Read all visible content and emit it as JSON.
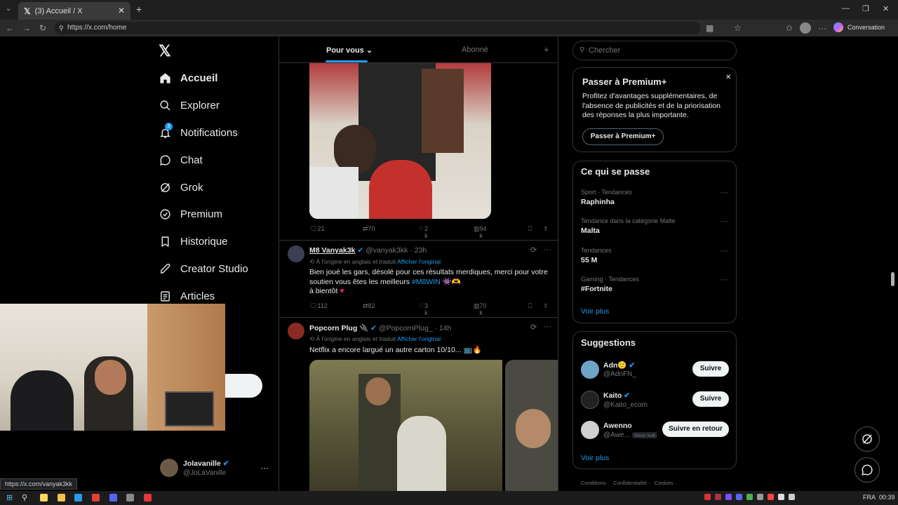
{
  "browser": {
    "tab_title": "(3) Accueil / X",
    "url": "https://x.com/home",
    "conversation_label": "Conversation",
    "status_url": "https://x.com/vanyak3kk"
  },
  "nav": {
    "items": [
      {
        "label": "Accueil",
        "icon": "home-icon"
      },
      {
        "label": "Explorer",
        "icon": "search-icon"
      },
      {
        "label": "Notifications",
        "icon": "bell-icon",
        "badge": "3"
      },
      {
        "label": "Chat",
        "icon": "chat-icon"
      },
      {
        "label": "Grok",
        "icon": "grok-icon"
      },
      {
        "label": "Premium",
        "icon": "premium-icon"
      },
      {
        "label": "Historique",
        "icon": "bookmark-icon"
      },
      {
        "label": "Creator Studio",
        "icon": "rocket-icon"
      },
      {
        "label": "Articles",
        "icon": "article-icon"
      }
    ],
    "profile": {
      "name": "Jolavanille",
      "handle": "@JoLaVanille"
    }
  },
  "timeline": {
    "tabs": [
      "Pour vous",
      "Abonné"
    ],
    "tweet1_stats": {
      "replies": "21",
      "retweets": "70",
      "likes": "2 k",
      "views": "94 k"
    },
    "tweet2": {
      "name": "M8 Vanyak3k",
      "handle": "@vanyak3kk",
      "time": "· 23h",
      "translated_note": "À l'origine en anglais et traduit",
      "show_original": "Afficher l'original",
      "text1": "Bien joué les gars, désolé pour ces résultats merdiques, merci pour votre",
      "text2_pre": "soutien vous êtes les meilleurs",
      "hashtag": "#M8WIN",
      "text3": "à bientôt",
      "stats": {
        "replies": "112",
        "retweets": "82",
        "likes": "3 k",
        "views": "70 k"
      }
    },
    "tweet3": {
      "name": "Popcorn Plug",
      "handle": "@PopcornPlug_",
      "time": "· 14h",
      "translated_note": "À l'origine en anglais et traduit",
      "show_original": "Afficher l'original",
      "text": "Netflix a encore largué un autre carton 10/10..."
    }
  },
  "sidebar": {
    "search_placeholder": "Chercher",
    "premium": {
      "title": "Passer à Premium+",
      "body1": "Profitez d'avantages supplémentaires, de",
      "body2": "l'absence de publicités et de la priorisation",
      "body3": "des réponses la plus importante.",
      "button": "Passer à Premium+"
    },
    "trends": {
      "title": "Ce qui se passe",
      "items": [
        {
          "context": "Sport · Tendances",
          "name": "Raphinha"
        },
        {
          "context": "Tendance dans la catégorie Malte",
          "name": "Malta"
        },
        {
          "context": "Tendances",
          "name": "55 M"
        },
        {
          "context": "Gaming · Tendances",
          "name": "#Fortnite"
        }
      ],
      "more": "Voir plus"
    },
    "suggestions": {
      "title": "Suggestions",
      "items": [
        {
          "name": "Adn🙂",
          "handle": "@AdnFN_",
          "button": "Suivre"
        },
        {
          "name": "Kaito",
          "handle": "@Kaito_ecom",
          "button": "Suivre"
        },
        {
          "name": "Awenno",
          "handle": "@Awe...",
          "badge": "Vous suit",
          "button": "Suivre en retour"
        }
      ],
      "more": "Voir plus"
    },
    "footer": [
      "Conditions",
      "Confidentialité",
      "Cookies"
    ]
  },
  "taskbar": {
    "lang": "FRA",
    "time": "00:39"
  },
  "colors": {
    "accent": "#1d9bf0",
    "bg": "#000000",
    "border": "#2f3336",
    "muted": "#71767b"
  }
}
